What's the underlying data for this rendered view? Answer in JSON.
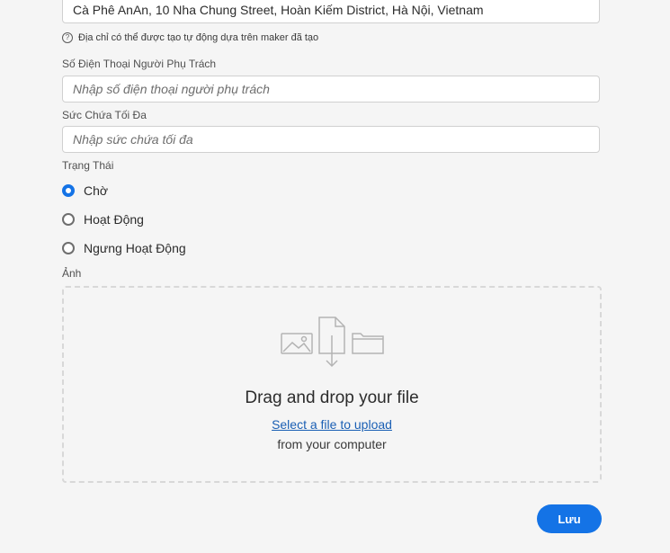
{
  "address": {
    "value": "Cà Phê AnAn, 10 Nha Chung Street, Hoàn Kiếm District, Hà Nội, Vietnam",
    "hint": "Địa chỉ có thể được tạo tự động dựa trên maker đã tạo",
    "hint_icon": "help-circle-icon"
  },
  "phone": {
    "label": "Số Điện Thoại Người Phụ Trách",
    "placeholder": "Nhập số điện thoại người phụ trách",
    "value": ""
  },
  "capacity": {
    "label": "Sức Chứa Tối Đa",
    "placeholder": "Nhập sức chứa tối đa",
    "value": ""
  },
  "status": {
    "label": "Trạng Thái",
    "options": [
      {
        "label": "Chờ",
        "checked": true
      },
      {
        "label": "Hoạt Động",
        "checked": false
      },
      {
        "label": "Ngưng Hoạt Động",
        "checked": false
      }
    ]
  },
  "image": {
    "label": "Ảnh",
    "heading": "Drag and drop your file",
    "link": "Select a file to upload",
    "subtext": "from your computer",
    "illustration_icon": "upload-illustration-icon"
  },
  "save_label": "Lưu",
  "colors": {
    "accent": "#1473e6",
    "link": "#1a5fb4",
    "background": "#f5f5f5"
  }
}
